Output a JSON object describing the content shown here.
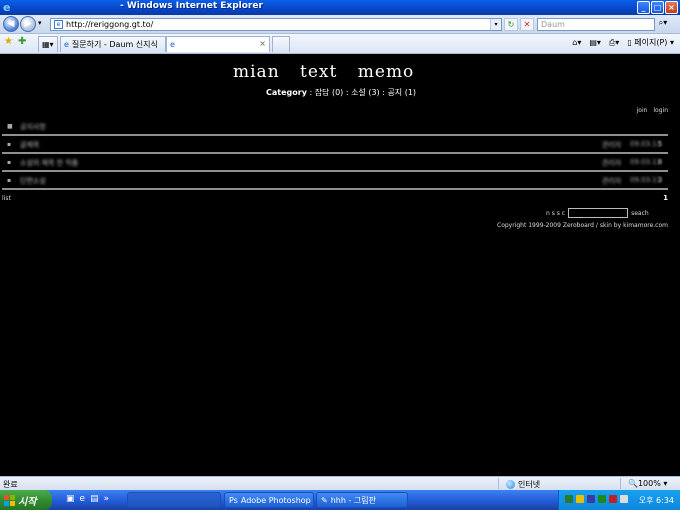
{
  "window": {
    "title": "- Windows Internet Explorer"
  },
  "address": {
    "url": "http://reriggong.gt.to/",
    "search_placeholder": "Daum"
  },
  "tabs": [
    {
      "label": "질문하기 - Daum 신지식"
    },
    {
      "label": ""
    }
  ],
  "cmdbar": {
    "page_menu": "페이지(P)"
  },
  "site": {
    "title": "mian text memo",
    "category_label": "Category",
    "category_items": ": 잡담 (0) : 소설 (3) : 공지 (1)",
    "join": "join",
    "login": "login",
    "list_link": "list",
    "page": "1",
    "search_options": "n s s c",
    "search_button": "seach",
    "copyright": "Copyright 1999-2009 Zeroboard / skin by kimamore.com"
  },
  "rows": [
    {
      "subject": "공지사항",
      "author": "",
      "date": "",
      "hit": ""
    },
    {
      "subject": "글제목",
      "author": "관리자",
      "date": "09.03.11",
      "hit": "5"
    },
    {
      "subject": "소설의 제목 한 작품",
      "author": "관리자",
      "date": "09.03.11",
      "hit": "8"
    },
    {
      "subject": "단편소설",
      "author": "관리자",
      "date": "09.03.11",
      "hit": "3"
    }
  ],
  "statusbar": {
    "status": "완료",
    "zone": "인터넷",
    "zoom": "100%"
  },
  "taskbar": {
    "start": "시작",
    "buttons": [
      "Adobe Photoshop ...",
      "hhh - 그림판"
    ],
    "clock": "오후 6:34"
  }
}
